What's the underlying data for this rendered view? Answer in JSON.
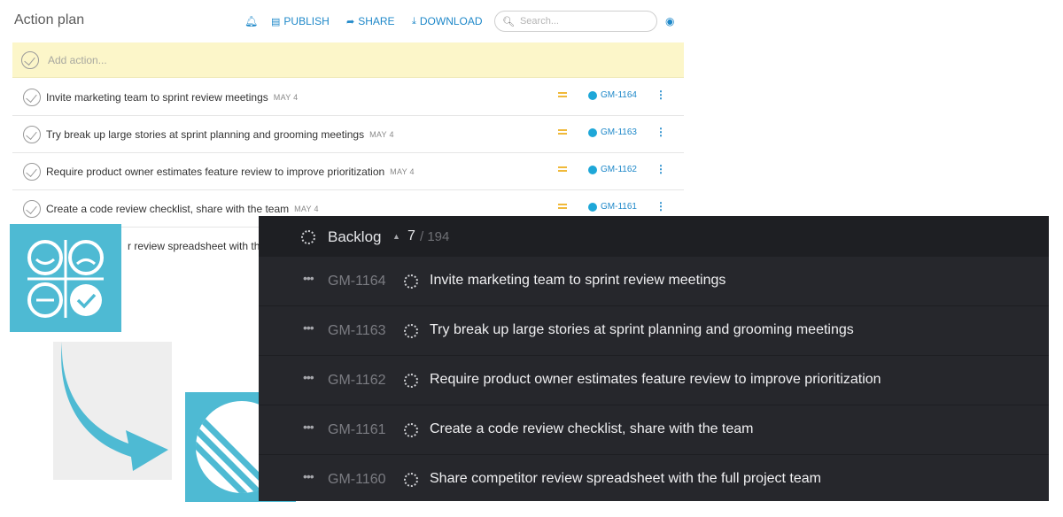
{
  "action_plan": {
    "title": "Action plan",
    "toolbar": {
      "publish": "PUBLISH",
      "share": "SHARE",
      "download": "DOWNLOAD"
    },
    "search_placeholder": "Search...",
    "add_placeholder": "Add action...",
    "items": [
      {
        "text": "Invite marketing team to sprint review meetings",
        "date": "MAY 4",
        "id": "GM-1164"
      },
      {
        "text": "Try break up large stories at sprint planning and grooming meetings",
        "date": "MAY 4",
        "id": "GM-1163"
      },
      {
        "text": "Require product owner estimates feature review to improve prioritization",
        "date": "MAY 4",
        "id": "GM-1162"
      },
      {
        "text": "Create a code review checklist, share with the team",
        "date": "MAY 4",
        "id": "GM-1161"
      },
      {
        "text": "r review spreadsheet with the",
        "date": "",
        "id": ""
      }
    ],
    "colors": {
      "accent": "#1e88c9",
      "add_row_bg": "#fcf6c9",
      "priority": "#f0b93a"
    }
  },
  "backlog": {
    "title": "Backlog",
    "count": "7",
    "total": "/ 194",
    "items": [
      {
        "id": "GM-1164",
        "text": "Invite marketing team to sprint review meetings"
      },
      {
        "id": "GM-1163",
        "text": "Try break up large stories at sprint planning and grooming meetings"
      },
      {
        "id": "GM-1162",
        "text": "Require product owner estimates feature review to improve prioritization"
      },
      {
        "id": "GM-1161",
        "text": "Create a code review checklist, share with the team"
      },
      {
        "id": "GM-1160",
        "text": "Share competitor review spreadsheet with the full project team"
      }
    ],
    "colors": {
      "bg": "#26272c",
      "header_bg": "#1e1f23"
    }
  },
  "logos": {
    "source_color": "#4ebad3",
    "icons": [
      "retro-quadrants-logo-icon",
      "arrow-icon",
      "linear-logo-icon"
    ]
  }
}
